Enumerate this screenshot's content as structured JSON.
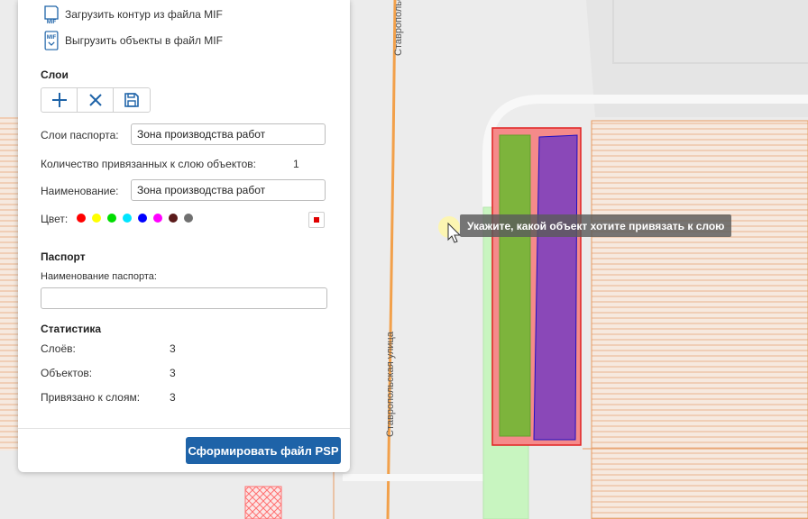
{
  "map": {
    "street_label_top": "Ставропольская улица",
    "street_label_bottom": "Ставропольская улица",
    "tooltip": "Укажите, какой объект хотите привязать к слою"
  },
  "colors": {
    "accent": "#1e63a8",
    "palette": [
      "#ff0000",
      "#ffff00",
      "#00dd00",
      "#00e5ff",
      "#0000ff",
      "#ff00ff",
      "#5a1a1a",
      "#707070"
    ]
  },
  "panel": {
    "load_contour_label": "Загрузить контур из файла MIF",
    "export_objects_label": "Выгрузить объекты в файл MIF",
    "mif_icon_text": "MIF",
    "layers": {
      "title": "Слои",
      "passport_layers_label": "Слои паспорта:",
      "passport_layers_value": "Зона производства работ",
      "linked_count_label": "Количество привязанных к слою объектов:",
      "linked_count_value": "1",
      "name_label": "Наименование:",
      "name_value": "Зона производства работ",
      "color_label": "Цвет:",
      "selected_color": "#e00000"
    },
    "passport": {
      "title": "Паспорт",
      "name_label": "Наименование паспорта:",
      "name_value": ""
    },
    "stats": {
      "title": "Статистика",
      "layers_label": "Слоёв:",
      "layers_value": "3",
      "objects_label": "Объектов:",
      "objects_value": "3",
      "linked_label": "Привязано к слоям:",
      "linked_value": "3"
    },
    "generate_button": "Сформировать файл PSP"
  }
}
